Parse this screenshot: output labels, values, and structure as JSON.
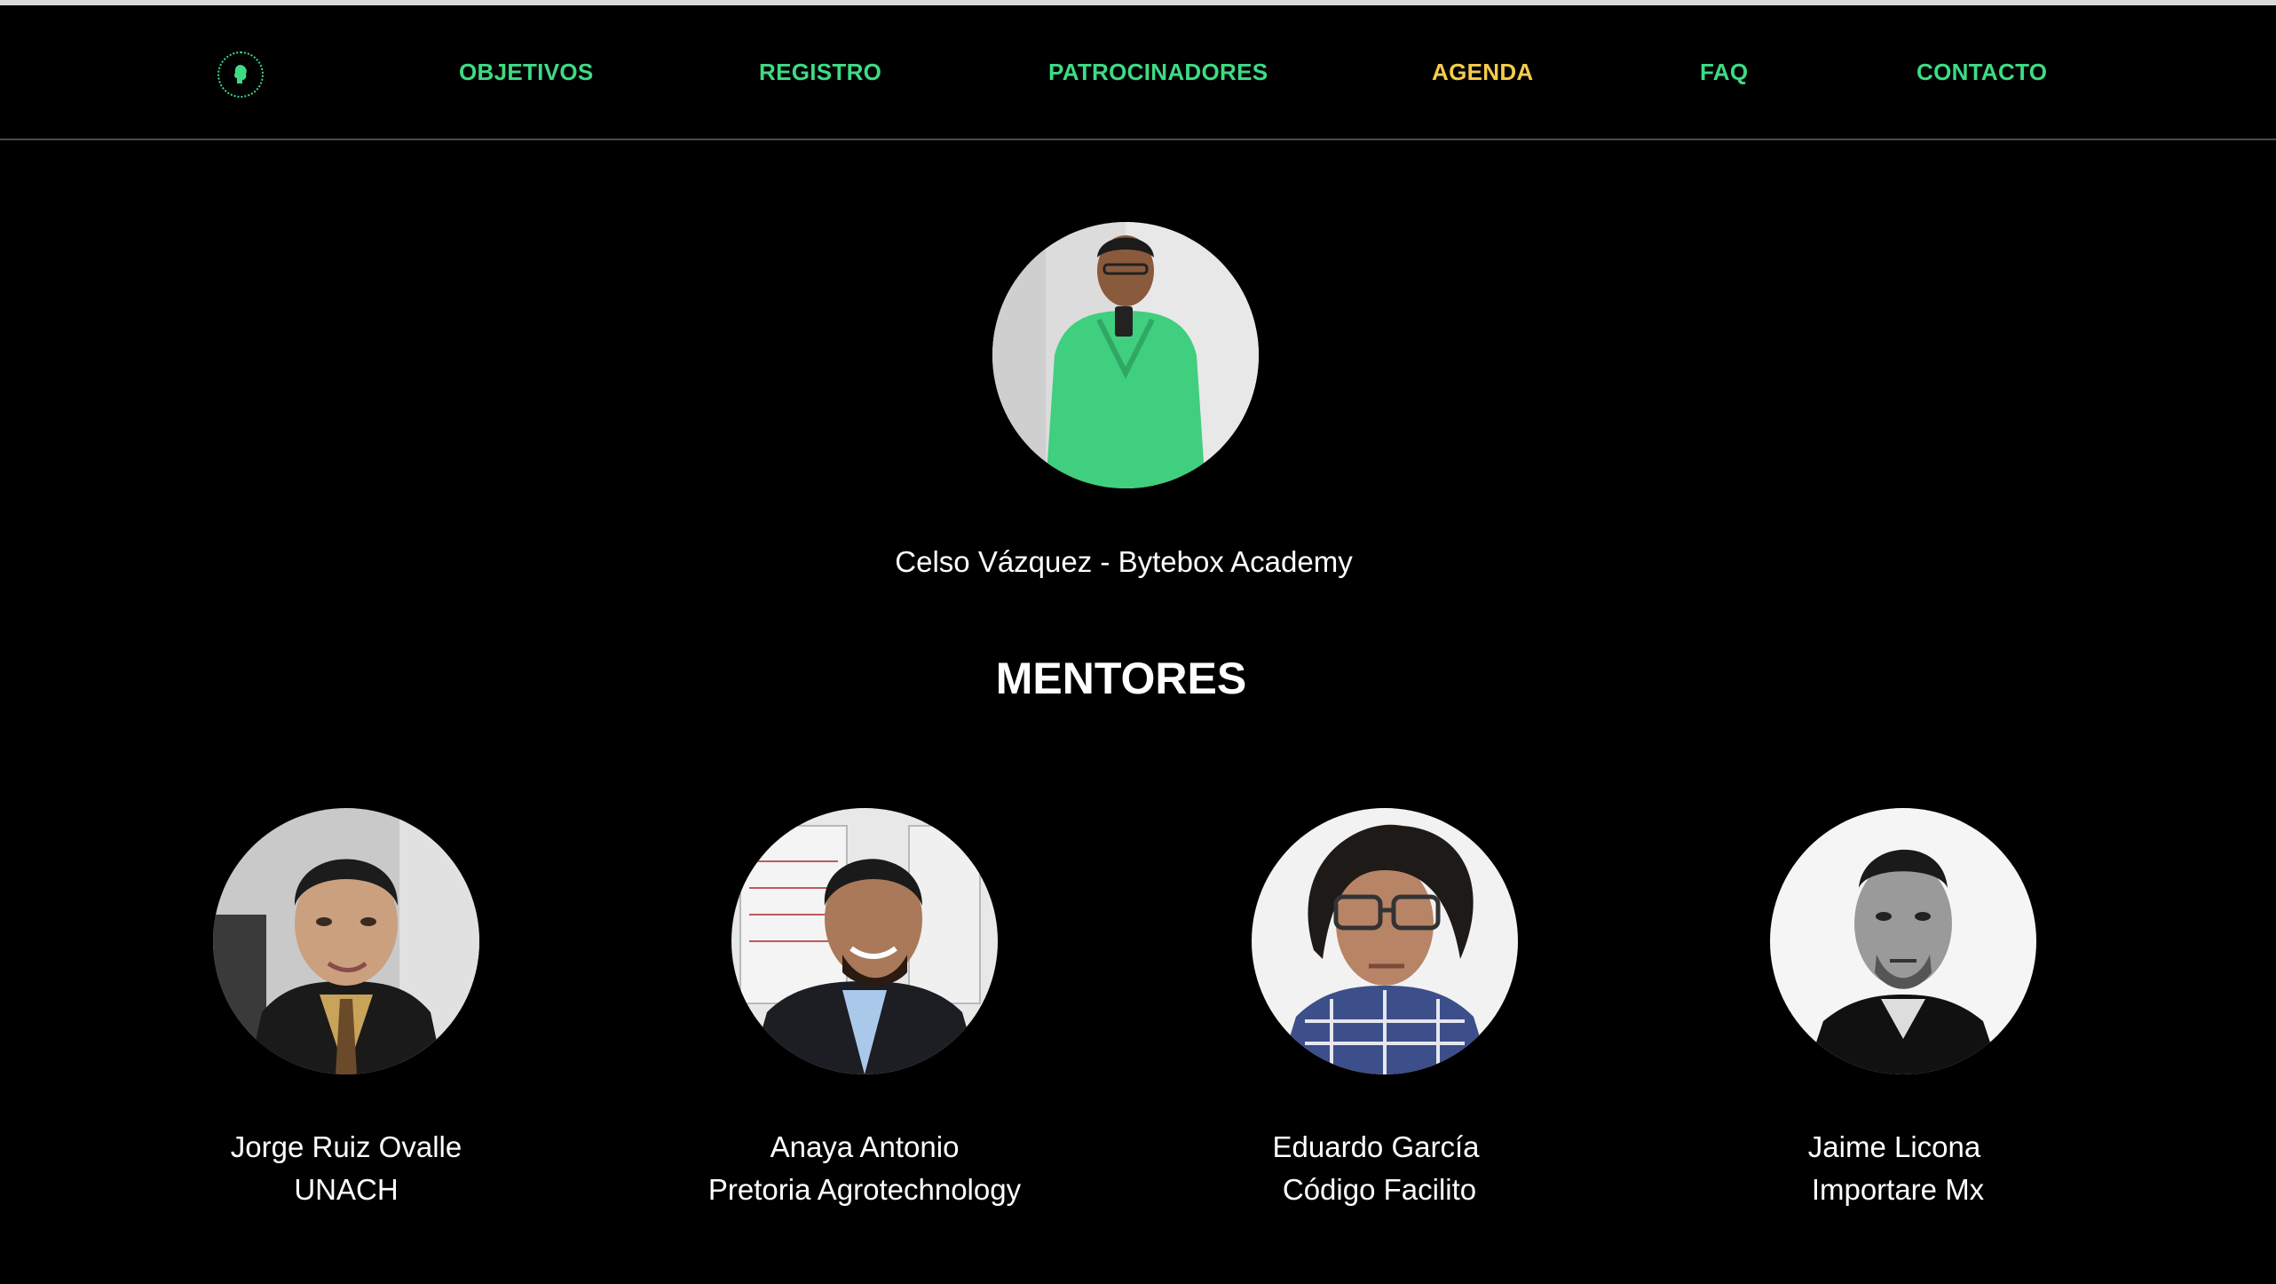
{
  "nav": {
    "items": [
      {
        "label": "OBJETIVOS",
        "color": "#3ddc84"
      },
      {
        "label": "REGISTRO",
        "color": "#3ddc84"
      },
      {
        "label": "PATROCINADORES",
        "color": "#3ddc84"
      },
      {
        "label": "AGENDA",
        "color": "#f5cc4a"
      },
      {
        "label": "FAQ",
        "color": "#3ddc84"
      },
      {
        "label": "CONTACTO",
        "color": "#3ddc84"
      }
    ]
  },
  "featured": {
    "caption": "Celso Vázquez - Bytebox Academy"
  },
  "mentors_section": {
    "title": "MENTORES"
  },
  "mentors": [
    {
      "name": "Jorge Ruiz Ovalle",
      "org": "UNACH"
    },
    {
      "name": "Anaya Antonio",
      "org": "Pretoria Agrotechnology"
    },
    {
      "name": "Eduardo García",
      "org": "Código Facilito"
    },
    {
      "name": "Jaime Licona",
      "org": "Importare Mx"
    }
  ]
}
